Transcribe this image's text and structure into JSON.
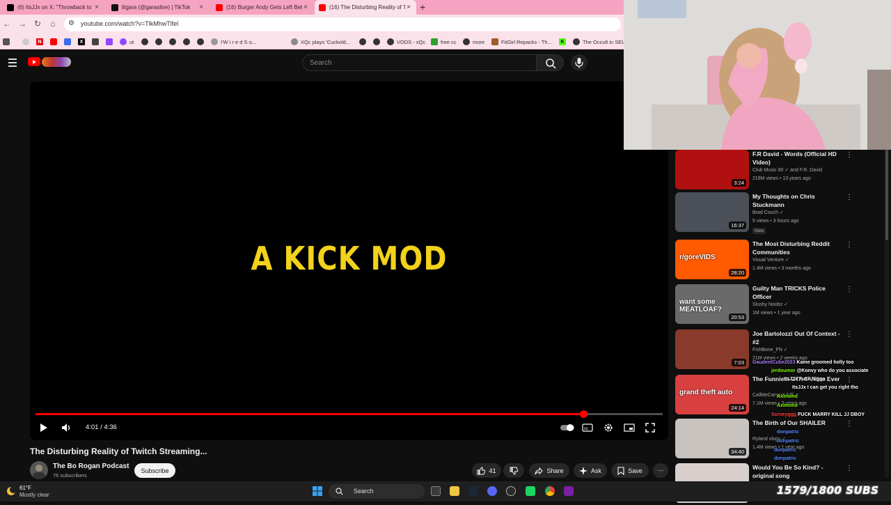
{
  "browser": {
    "tabs": [
      {
        "title": "(6) ItsJJx on X: \"Throwback to w"
      },
      {
        "title": "lilgara (@garaslive) | TikTok"
      },
      {
        "title": "(16) Burger Andy Gets Left Beh"
      },
      {
        "title": "(16) The Disturbing Reality of T"
      }
    ],
    "url": "youtube.com/watch?v=TlkMhwTlfel",
    "bookmarks": [
      {
        "label": "ut",
        "color": "#9146ff"
      },
      {
        "label": "I'W i r e d   S o...",
        "color": "#999999"
      },
      {
        "label": "XQc plays 'Cuckold...",
        "color": "#888888"
      },
      {
        "label": "VODS - xQc",
        "color": "#333333"
      },
      {
        "label": "free cc",
        "color": "#2ca02c"
      },
      {
        "label": "more",
        "color": "#333333"
      },
      {
        "label": "FitGirl Repacks - Th...",
        "color": "#a05a2c"
      },
      {
        "label": "The Occult in SEL",
        "color": "#333333"
      }
    ]
  },
  "youtube": {
    "search_placeholder": "Search",
    "video": {
      "overlay_text": "A KICK MOD",
      "time": "4:01 / 4:36",
      "progress": 0.873,
      "title": "The Disturbing Reality of Twitch Streaming...",
      "channel": "The Bo Rogan Podcast",
      "subscribers": "76 subscribers",
      "subscribe_label": "Subscribe",
      "likes": "41",
      "share_label": "Share",
      "ask_label": "Ask",
      "save_label": "Save"
    },
    "recommendations": [
      {
        "title": "F.R David - Words (Official HD Video)",
        "channel": "Club Music 80",
        "extra": "and F.R. David",
        "meta": "216M views • 13 years ago",
        "duration": "3:24",
        "thumb_color": "#b01010"
      },
      {
        "title": "My Thoughts on Chris Stuckmann",
        "channel": "Brad Couch",
        "meta": "5 views • 3 hours ago",
        "badge": "New",
        "duration": "16:37",
        "thumb_color": "#4a4f58"
      },
      {
        "title": "The Most Disturbing Reddit Communities",
        "channel": "Visual Venture",
        "meta": "1.4M views • 3 months ago",
        "duration": "28:20",
        "thumb_color": "#ff5a00",
        "thumb_text": "r/goreVIDS"
      },
      {
        "title": "Guilty Man TRICKS Police Officer",
        "channel": "Slushy Noobz",
        "meta": "1M views • 1 year ago",
        "duration": "20:53",
        "thumb_color": "#6a6a6a",
        "thumb_text": "want some MEATLOAF?"
      },
      {
        "title": "Joe Bartolozzi Out Of Context - #2",
        "channel": "FishBone_FN",
        "meta": "21M views • 2 weeks ago",
        "duration": "7:03",
        "thumb_color": "#8a3a2a"
      },
      {
        "title": "The Funniest GTA 5 Video Ever",
        "channel": "CallMeCarsonLIVE",
        "meta": "7.1M views • 2 years ago",
        "duration": "24:14",
        "thumb_color": "#d84040",
        "thumb_text": "grand theft auto"
      },
      {
        "title": "The Birth of Our SHAILER",
        "channel": "Ryland vlogs",
        "meta": "1.4M views • 1 year ago",
        "duration": "34:40",
        "thumb_color": "#c9c3c0"
      },
      {
        "title": "Would You Be So Kind? - original song",
        "channel": "",
        "meta": "",
        "duration": "",
        "thumb_color": "#d8cfcc"
      }
    ]
  },
  "chat": [
    {
      "user": "GaudentCube2023",
      "text": "Kame groomed holly too",
      "color": "#b07cff"
    },
    {
      "user": "jerdoumor",
      "text": "@Konvy who do you associate",
      "color": "#7fff00"
    },
    {
      "user": "ItsJJx",
      "text": "Fuck Nigga",
      "color": "#ffffff"
    },
    {
      "user": "",
      "text": "ItsJJx I can get you right tho",
      "color": "#ffffff"
    },
    {
      "user": "Axlmond",
      "text": "",
      "color": "#7fff00"
    },
    {
      "user": "Axlmond",
      "text": "",
      "color": "#7fff00"
    },
    {
      "user": "Surveyggg",
      "text": "FUCK MARRY KILL JJ DBOY",
      "color": "#ff4040"
    },
    {
      "user": "donpatric",
      "text": "",
      "color": "#5b8cff"
    },
    {
      "user": "donpatric",
      "text": "",
      "color": "#5b8cff"
    },
    {
      "user": "donpatric",
      "text": "",
      "color": "#5b8cff"
    },
    {
      "user": "donpatric",
      "text": "",
      "color": "#5b8cff"
    }
  ],
  "overlay": {
    "sub_goal": "1579/1800 SUBS"
  },
  "taskbar": {
    "temperature": "61°F",
    "weather": "Mostly clear",
    "search_label": "Search"
  }
}
